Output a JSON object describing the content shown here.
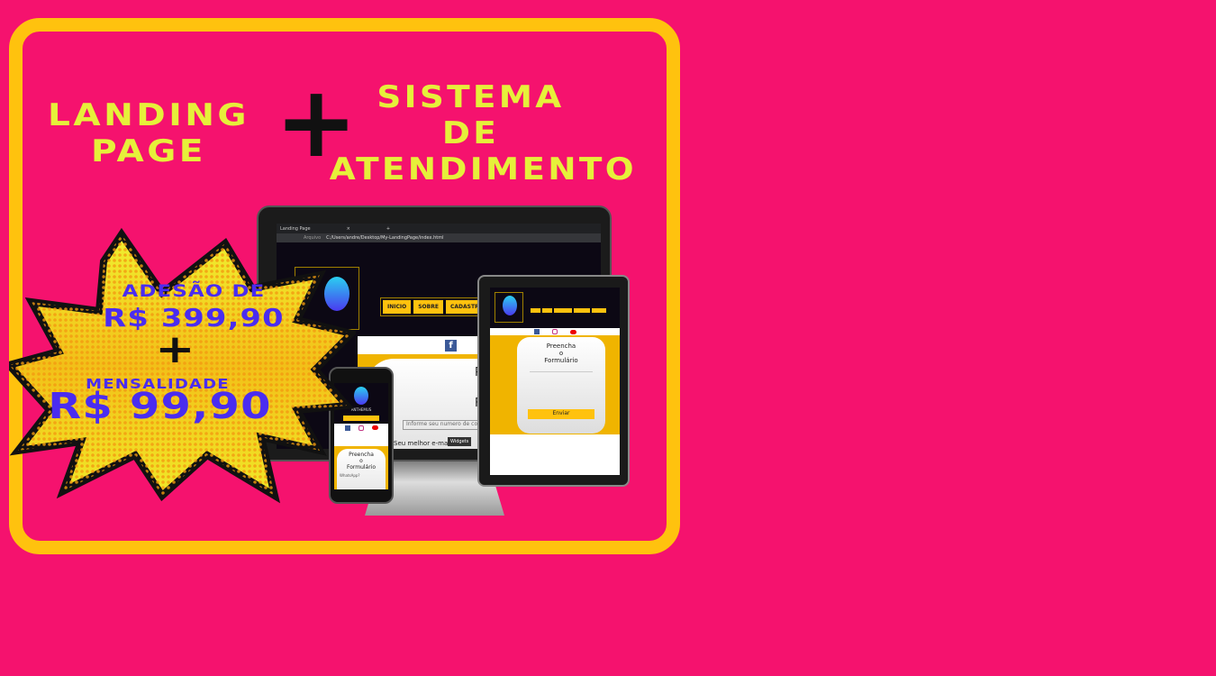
{
  "headline": {
    "left": [
      "LANDING",
      "PAGE"
    ],
    "plus": "+",
    "right": [
      "SISTEMA",
      "DE",
      "ATENDIMENTO"
    ]
  },
  "offer": {
    "adhesion_label": "ADESÃO DE",
    "adhesion_price": "R$ 399,90",
    "plus": "+",
    "monthly_label": "MENSALIDADE",
    "monthly_price": "R$ 99,90"
  },
  "mockup": {
    "browser_tab": "Landing Page",
    "tab_close": "×",
    "new_tab": "+",
    "url_prefix": "Arquivo",
    "url": "C:/Users/andre/Desktop/My-LandingPage/index.html",
    "nav": [
      "INICIO",
      "SOBRE",
      "CADASTRE -SE"
    ],
    "form_title": [
      "Preencha",
      "o",
      "Formulário"
    ],
    "form_hint": "Informe seu numero de contato",
    "email_label": "Seu melhor e-mail",
    "whatsapp_label": "WhatsApp?",
    "tooltip": "Widgets",
    "submit": "Enviar",
    "brand": "ANTHEMUS",
    "fb": "f"
  },
  "colors": {
    "background": "#F5126E",
    "frame": "#FFC20E",
    "headline": "#E6F03A",
    "price": "#4A2CF0"
  }
}
